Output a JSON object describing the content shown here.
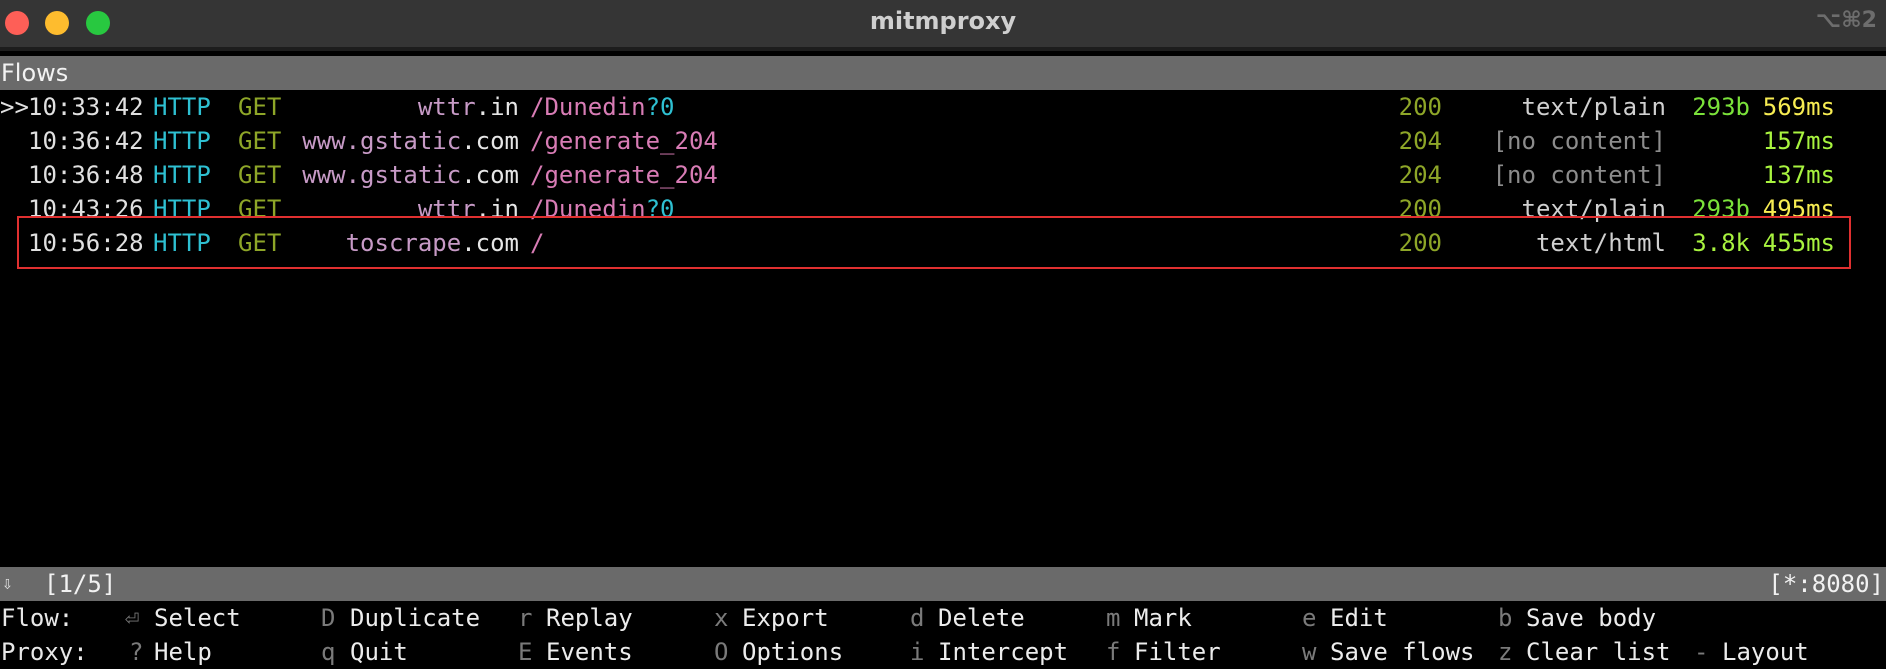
{
  "window": {
    "title": "mitmproxy",
    "shortcut": "⌥⌘2"
  },
  "flows_header": "Flows",
  "flows": [
    {
      "cursor": ">>",
      "time": "10:33:42",
      "proto": "HTTP",
      "method": "GET",
      "host_a": "wttr",
      "host_b": ".in",
      "host_c": "",
      "path_main": "/Dunedin",
      "path_q": "?0",
      "code": "200",
      "ctype": "text/plain",
      "size": "293b",
      "duration": "569ms"
    },
    {
      "cursor": "",
      "time": "10:36:42",
      "proto": "HTTP",
      "method": "GET",
      "host_a": "www.gstatic",
      "host_b": ".com",
      "host_c": "",
      "path_main": "/generate_204",
      "path_q": "",
      "code": "204",
      "ctype": "[no content]",
      "size": "",
      "duration": "157ms"
    },
    {
      "cursor": "",
      "time": "10:36:48",
      "proto": "HTTP",
      "method": "GET",
      "host_a": "www.gstatic",
      "host_b": ".com",
      "host_c": "",
      "path_main": "/generate_204",
      "path_q": "",
      "code": "204",
      "ctype": "[no content]",
      "size": "",
      "duration": "137ms"
    },
    {
      "cursor": "",
      "time": "10:43:26",
      "proto": "HTTP",
      "method": "GET",
      "host_a": "wttr",
      "host_b": ".in",
      "host_c": "",
      "path_main": "/Dunedin",
      "path_q": "?0",
      "code": "200",
      "ctype": "text/plain",
      "size": "293b",
      "duration": "495ms"
    },
    {
      "cursor": "",
      "time": "10:56:28",
      "proto": "HTTP",
      "method": "GET",
      "host_a": "toscrape",
      "host_b": ".com",
      "host_c": "",
      "path_main": "/",
      "path_q": "",
      "code": "200",
      "ctype": "text/html",
      "size": "3.8k",
      "duration": "455ms"
    }
  ],
  "status": {
    "arrow": "⇩",
    "position": "[1/5]",
    "listen": "[*:8080]"
  },
  "keyhelp": {
    "flow_label": "Flow:",
    "proxy_label": "Proxy:",
    "flow_keys": [
      {
        "key": "⏎",
        "action": "Select"
      },
      {
        "key": "D",
        "action": "Duplicate"
      },
      {
        "key": "r",
        "action": "Replay"
      },
      {
        "key": "x",
        "action": "Export"
      },
      {
        "key": "d",
        "action": "Delete"
      },
      {
        "key": "m",
        "action": "Mark"
      },
      {
        "key": "e",
        "action": "Edit"
      },
      {
        "key": "b",
        "action": "Save body"
      }
    ],
    "proxy_keys": [
      {
        "key": "?",
        "action": "Help"
      },
      {
        "key": "q",
        "action": "Quit"
      },
      {
        "key": "E",
        "action": "Events"
      },
      {
        "key": "O",
        "action": "Options"
      },
      {
        "key": "i",
        "action": "Intercept"
      },
      {
        "key": "f",
        "action": "Filter"
      },
      {
        "key": "w",
        "action": "Save flows"
      },
      {
        "key": "z",
        "action": "Clear list"
      },
      {
        "key": "-",
        "action": "Layout"
      }
    ]
  },
  "colors": {
    "http": "#2ec0d2",
    "method": "#8ea628",
    "host": "#c79ac6",
    "path": "#d87cb5",
    "size": "#7be23a",
    "duration_slow": "#f7ec52",
    "duration_fast": "#a8f33f",
    "highlight": "#e03030"
  }
}
